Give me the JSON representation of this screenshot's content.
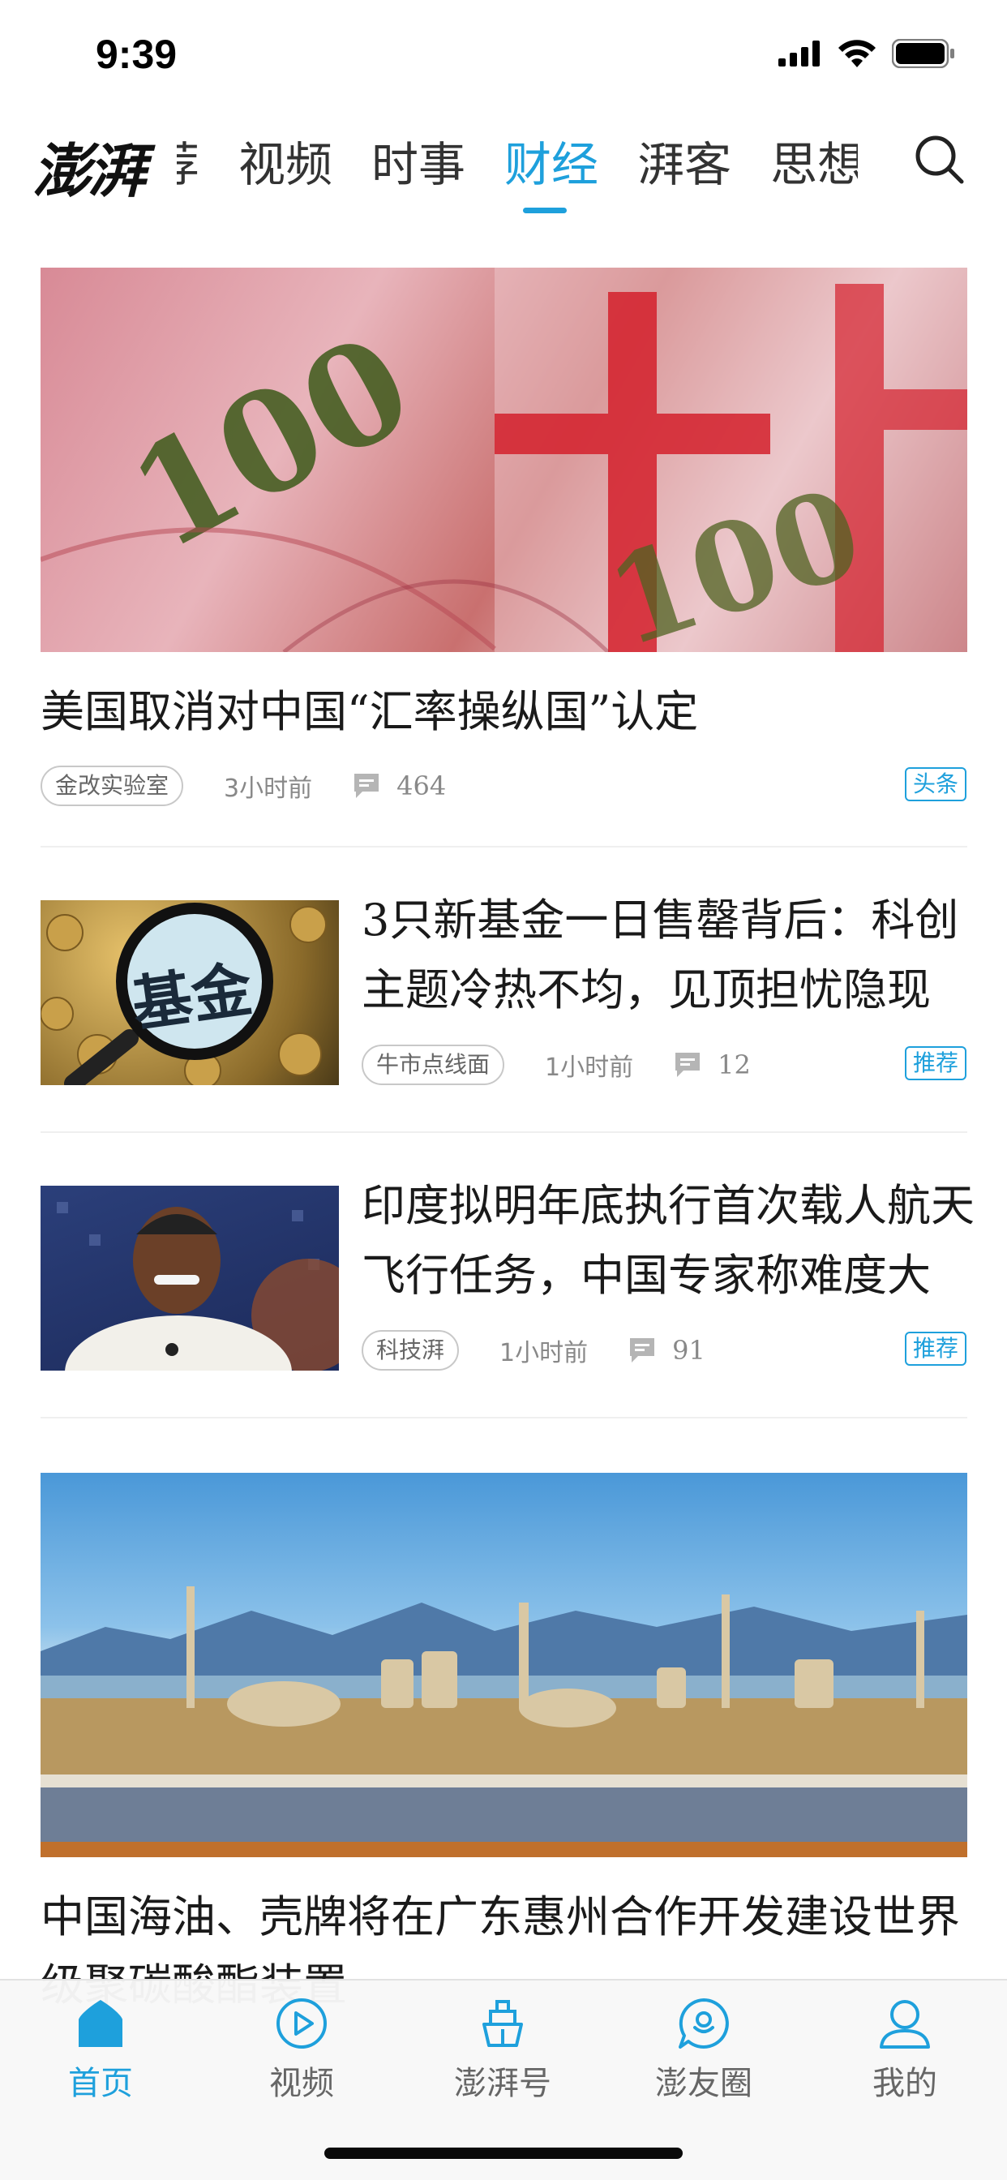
{
  "status_bar": {
    "time": "9:39"
  },
  "app": {
    "logo_text": "澎湃"
  },
  "nav": {
    "partial_tab": "荐",
    "tabs": [
      {
        "label": "视频",
        "active": false
      },
      {
        "label": "时事",
        "active": false
      },
      {
        "label": "财经",
        "active": true
      },
      {
        "label": "湃客",
        "active": false
      },
      {
        "label": "思想",
        "active": false
      }
    ],
    "search_icon": "search-icon"
  },
  "feed": {
    "articles": [
      {
        "title": "美国取消对中国“汇率操纵国”认定",
        "tag": "金改实验室",
        "time": "3小时前",
        "comments": "464",
        "badge": "头条",
        "layout": "large"
      },
      {
        "title": "3只新基金一日售罄背后：科创主题冷热不均，见顶担忧隐现",
        "tag": "牛市点线面",
        "time": "1小时前",
        "comments": "12",
        "badge": "推荐",
        "layout": "thumb",
        "thumb_text": "基金"
      },
      {
        "title": "印度拟明年底执行首次载人航天飞行任务，中国专家称难度大",
        "tag": "科技湃",
        "time": "1小时前",
        "comments": "91",
        "badge": "推荐",
        "layout": "thumb"
      },
      {
        "title": "中国海油、壳牌将在广东惠州合作开发建设世界级聚碳酸酯装置",
        "layout": "large"
      }
    ]
  },
  "tabbar": {
    "items": [
      {
        "label": "首页",
        "icon": "home-icon",
        "active": true
      },
      {
        "label": "视频",
        "icon": "play-icon",
        "active": false
      },
      {
        "label": "澎湃号",
        "icon": "ship-icon",
        "active": false
      },
      {
        "label": "澎友圈",
        "icon": "chat-bubble-icon",
        "active": false
      },
      {
        "label": "我的",
        "icon": "user-icon",
        "active": false
      }
    ]
  },
  "colors": {
    "accent": "#1ea0dc",
    "text": "#1a1a1a",
    "meta": "#888888"
  }
}
